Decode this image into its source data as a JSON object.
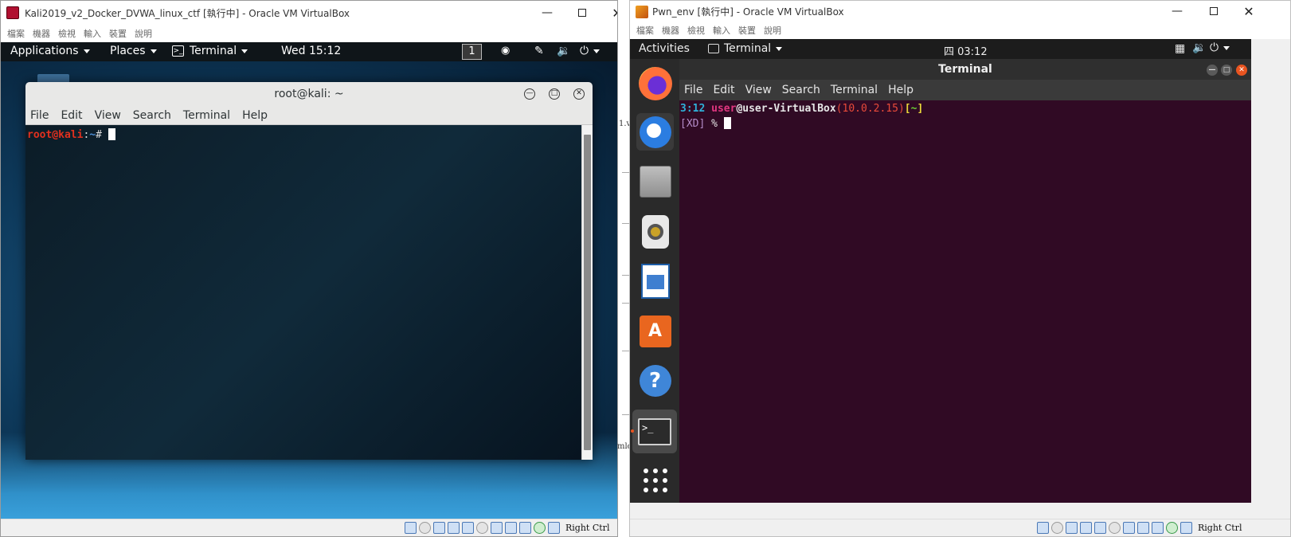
{
  "left_window": {
    "title": "Kali2019_v2_Docker_DVWA_linux_ctf [執行中] - Oracle VM VirtualBox",
    "menu": [
      "檔案",
      "機器",
      "檢視",
      "輸入",
      "裝置",
      "說明"
    ],
    "host_key": "Right Ctrl",
    "guest": {
      "panel": {
        "applications": "Applications",
        "places": "Places",
        "terminal": "Terminal",
        "clock": "Wed 15:12",
        "workspace": "1"
      },
      "terminal": {
        "title": "root@kali: ~",
        "menu": [
          "File",
          "Edit",
          "View",
          "Search",
          "Terminal",
          "Help"
        ],
        "prompt_user": "root@kali",
        "prompt_sep": ":",
        "prompt_path": "~",
        "prompt_symbol": "#"
      }
    }
  },
  "background_text": {
    "a": "1.v",
    "b": "mlo"
  },
  "right_window": {
    "title": "Pwn_env [執行中] - Oracle VM VirtualBox",
    "menu": [
      "檔案",
      "機器",
      "檢視",
      "輸入",
      "裝置",
      "說明"
    ],
    "host_key": "Right Ctrl",
    "guest": {
      "panel": {
        "activities": "Activities",
        "app": "Terminal",
        "clock": "四 03:12"
      },
      "dock": [
        "firefox",
        "thunderbird",
        "files",
        "rhythmbox",
        "libreoffice-writer",
        "software-center",
        "help",
        "terminal",
        "show-apps"
      ],
      "terminal": {
        "title": "Terminal",
        "menu": [
          "File",
          "Edit",
          "View",
          "Search",
          "Terminal",
          "Help"
        ],
        "line1": {
          "time": "3:12",
          "user": "user",
          "host": "@user-VirtualBox",
          "ip": "(10.0.2.15)",
          "dir_open": "[",
          "dir": "~",
          "dir_close": "]"
        },
        "line2": {
          "tag": "[XD]",
          "symbol": "%"
        }
      }
    }
  },
  "colors": {
    "kali_prompt": "#e1301e",
    "ubuntu_bg": "#300a24",
    "ubuntu_accent": "#e95420",
    "ip_color": "#e94a3a",
    "time_color": "#2fb0d8",
    "user_color": "#e13680",
    "dir_color": "#6dd236"
  }
}
